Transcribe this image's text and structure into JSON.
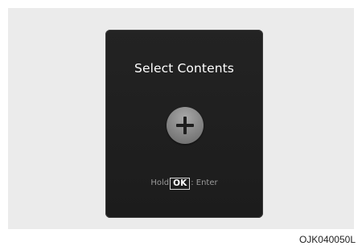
{
  "screen": {
    "title": "Select Contents",
    "add_icon": "plus-icon",
    "hint": {
      "prefix": "Hold",
      "key": "OK",
      "suffix": ": Enter"
    }
  },
  "figure_code": "OJK040050L",
  "colors": {
    "screen_background": "#1f1f1f",
    "title_text": "#ffffff",
    "hint_text": "#9a9a9a",
    "button_fill": "#8a8a8a",
    "frame_background": "#ebebeb"
  }
}
